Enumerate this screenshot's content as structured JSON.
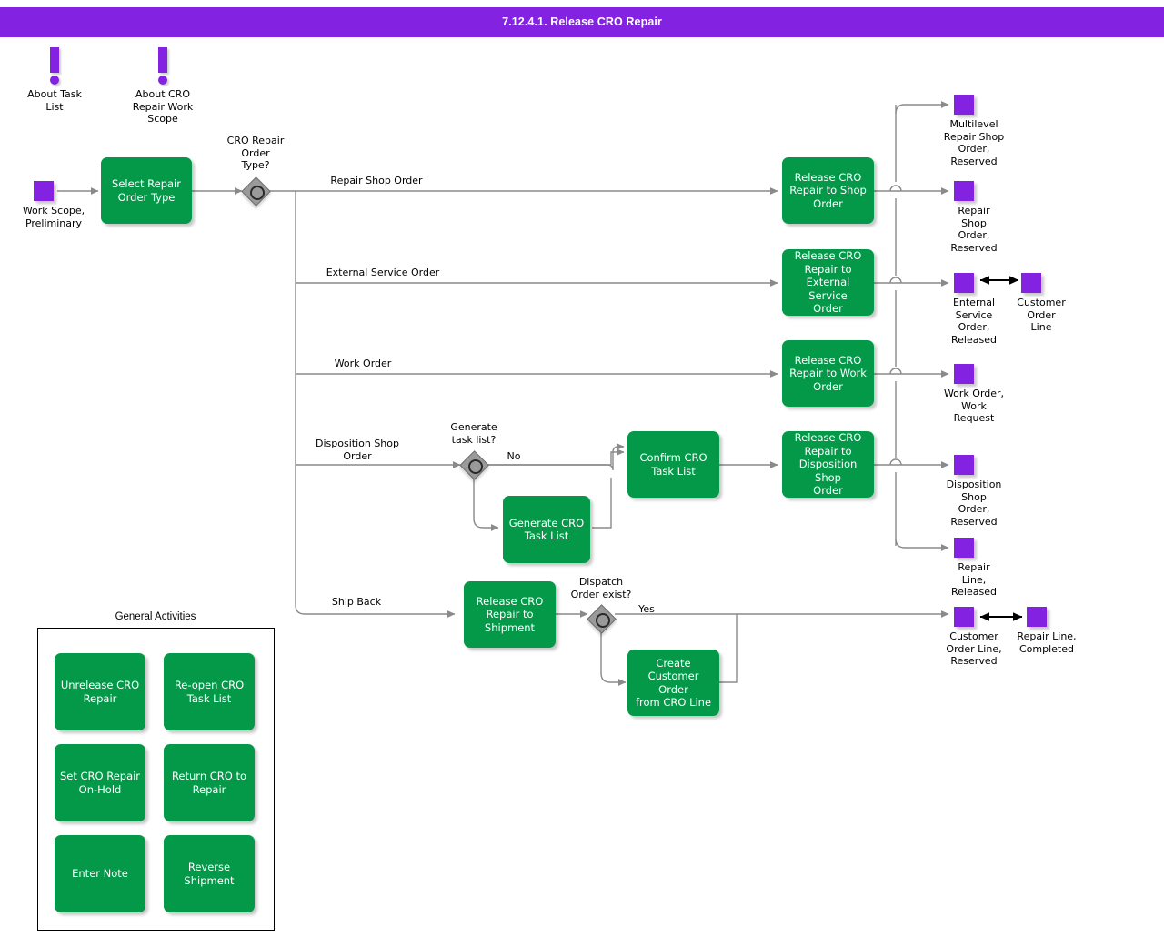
{
  "header": {
    "title": "7.12.4.1. Release CRO Repair",
    "bar_color": "#8322E0",
    "text_color": "#FFFFFF"
  },
  "palette": {
    "task_green": "#039949",
    "state_purple": "#8322E0",
    "gateway_gray": "#9A9A9A",
    "connector_gray": "#8A8A8A",
    "assoc_black": "#000000",
    "canvas": "#FFFFFF"
  },
  "annotations": [
    {
      "id": "about-task-list",
      "label": "About Task\nList"
    },
    {
      "id": "about-cro-work-scope",
      "label": "About CRO\nRepair Work\nScope"
    }
  ],
  "start_state": {
    "id": "work-scope-preliminary",
    "label": "Work Scope,\nPreliminary"
  },
  "tasks": [
    {
      "id": "select-repair-order-type",
      "label": "Select Repair\nOrder Type"
    },
    {
      "id": "release-cro-repair-shop-order",
      "label": "Release CRO\nRepair to Shop\nOrder"
    },
    {
      "id": "release-cro-repair-ext-service",
      "label": "Release CRO\nRepair to\nExternal Service\nOrder"
    },
    {
      "id": "release-cro-repair-work-order",
      "label": "Release CRO\nRepair to Work\nOrder"
    },
    {
      "id": "generate-cro-task-list",
      "label": "Generate CRO\nTask List"
    },
    {
      "id": "confirm-cro-task-list",
      "label": "Confirm CRO\nTask List"
    },
    {
      "id": "release-cro-repair-disp-shop",
      "label": "Release CRO\nRepair to\nDisposition Shop\nOrder"
    },
    {
      "id": "release-cro-repair-shipment",
      "label": "Release CRO\nRepair to\nShipment"
    },
    {
      "id": "create-customer-order-cro-line",
      "label": "Create\nCustomer Order\nfrom CRO Line"
    }
  ],
  "gateways": [
    {
      "id": "cro-repair-order-type",
      "label": "CRO Repair\nOrder\nType?"
    },
    {
      "id": "generate-task-list",
      "label": "Generate\ntask list?"
    },
    {
      "id": "dispatch-order-exist",
      "label": "Dispatch\nOrder exist?"
    }
  ],
  "flow_labels": [
    {
      "id": "branch-repair-shop-order",
      "text": "Repair Shop Order"
    },
    {
      "id": "branch-external-service-order",
      "text": "External Service Order"
    },
    {
      "id": "branch-work-order",
      "text": "Work Order"
    },
    {
      "id": "branch-disposition-shop-order",
      "text": "Disposition Shop\nOrder"
    },
    {
      "id": "branch-ship-back",
      "text": "Ship Back"
    },
    {
      "id": "branch-no",
      "text": "No"
    },
    {
      "id": "branch-yes",
      "text": "Yes"
    }
  ],
  "end_states": [
    {
      "id": "multilevel-repair-shop-order-reserved",
      "label": "Multilevel\nRepair Shop\nOrder,\nReserved"
    },
    {
      "id": "repair-shop-order-reserved",
      "label": "Repair\nShop\nOrder,\nReserved"
    },
    {
      "id": "enternal-service-order-released",
      "label": "Enternal\nService\nOrder,\nReleased"
    },
    {
      "id": "customer-order-line",
      "label": "Customer\nOrder\nLine"
    },
    {
      "id": "work-order-work-request",
      "label": "Work Order,\nWork\nRequest"
    },
    {
      "id": "disposition-shop-order-reserved",
      "label": "Disposition\nShop\nOrder,\nReserved"
    },
    {
      "id": "repair-line-released",
      "label": "Repair\nLine,\nReleased"
    },
    {
      "id": "customer-order-line-reserved",
      "label": "Customer\nOrder Line,\nReserved"
    },
    {
      "id": "repair-line-completed",
      "label": "Repair Line,\nCompleted"
    }
  ],
  "general_activities": {
    "title": "General Activities",
    "items": [
      {
        "id": "unrelease-cro-repair",
        "label": "Unrelease CRO\nRepair"
      },
      {
        "id": "re-open-cro-task-list",
        "label": "Re-open CRO\nTask List"
      },
      {
        "id": "set-cro-repair-on-hold",
        "label": "Set CRO Repair\nOn-Hold"
      },
      {
        "id": "return-cro-to-repair",
        "label": "Return CRO to\nRepair"
      },
      {
        "id": "enter-note",
        "label": "Enter Note"
      },
      {
        "id": "reverse-shipment",
        "label": "Reverse\nShipment"
      }
    ]
  },
  "diagram_data": {
    "type": "diagram",
    "notation": "BPMN-like process flow",
    "node_count": 9,
    "gateway_count": 3,
    "state_count": 10,
    "paths": [
      "Work Scope, Preliminary -> Select Repair Order Type -> CRO Repair Order Type?",
      "CRO Repair Order Type? -[Repair Shop Order]-> Release CRO Repair to Shop Order -> Multilevel Repair Shop Order, Reserved / Repair Shop Order, Reserved",
      "CRO Repair Order Type? -[External Service Order]-> Release CRO Repair to External Service Order -> Enternal Service Order, Released <-> Customer Order Line",
      "CRO Repair Order Type? -[Work Order]-> Release CRO Repair to Work Order -> Work Order, Work Request",
      "CRO Repair Order Type? -[Disposition Shop Order]-> Generate task list? -[No]-> Confirm CRO Task List; -[yes]-> Generate CRO Task List -> Confirm CRO Task List -> Release CRO Repair to Disposition Shop Order -> Disposition Shop Order, Reserved / Repair Line, Released",
      "CRO Repair Order Type? -[Ship Back]-> Release CRO Repair to Shipment -> Dispatch Order exist? -[Yes]-> Customer Order Line, Reserved; -[no]-> Create Customer Order from CRO Line -> Customer Order Line, Reserved <-> Repair Line, Completed"
    ]
  }
}
